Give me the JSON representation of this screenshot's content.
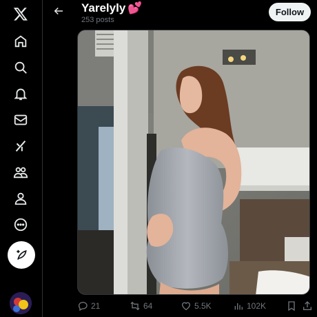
{
  "sidebar": {
    "items": [
      {
        "icon": "x-logo-icon"
      },
      {
        "icon": "home-icon"
      },
      {
        "icon": "search-icon"
      },
      {
        "icon": "notifications-bell-icon"
      },
      {
        "icon": "messages-envelope-icon"
      },
      {
        "icon": "grok-icon"
      },
      {
        "icon": "communities-icon"
      },
      {
        "icon": "profile-icon"
      },
      {
        "icon": "more-circle-icon"
      },
      {
        "icon": "compose-post-icon"
      }
    ]
  },
  "header": {
    "title": "Yarelyly",
    "title_emoji": "💕",
    "post_count": "253 posts",
    "follow_label": "Follow"
  },
  "actions": {
    "replies": "21",
    "reposts": "64",
    "likes": "5.5K",
    "views": "102K"
  },
  "colors": {
    "background": "#000000",
    "text": "#e7e9ea",
    "muted": "#71767b",
    "border": "#2f3336",
    "follow_bg": "#eff3f4"
  }
}
